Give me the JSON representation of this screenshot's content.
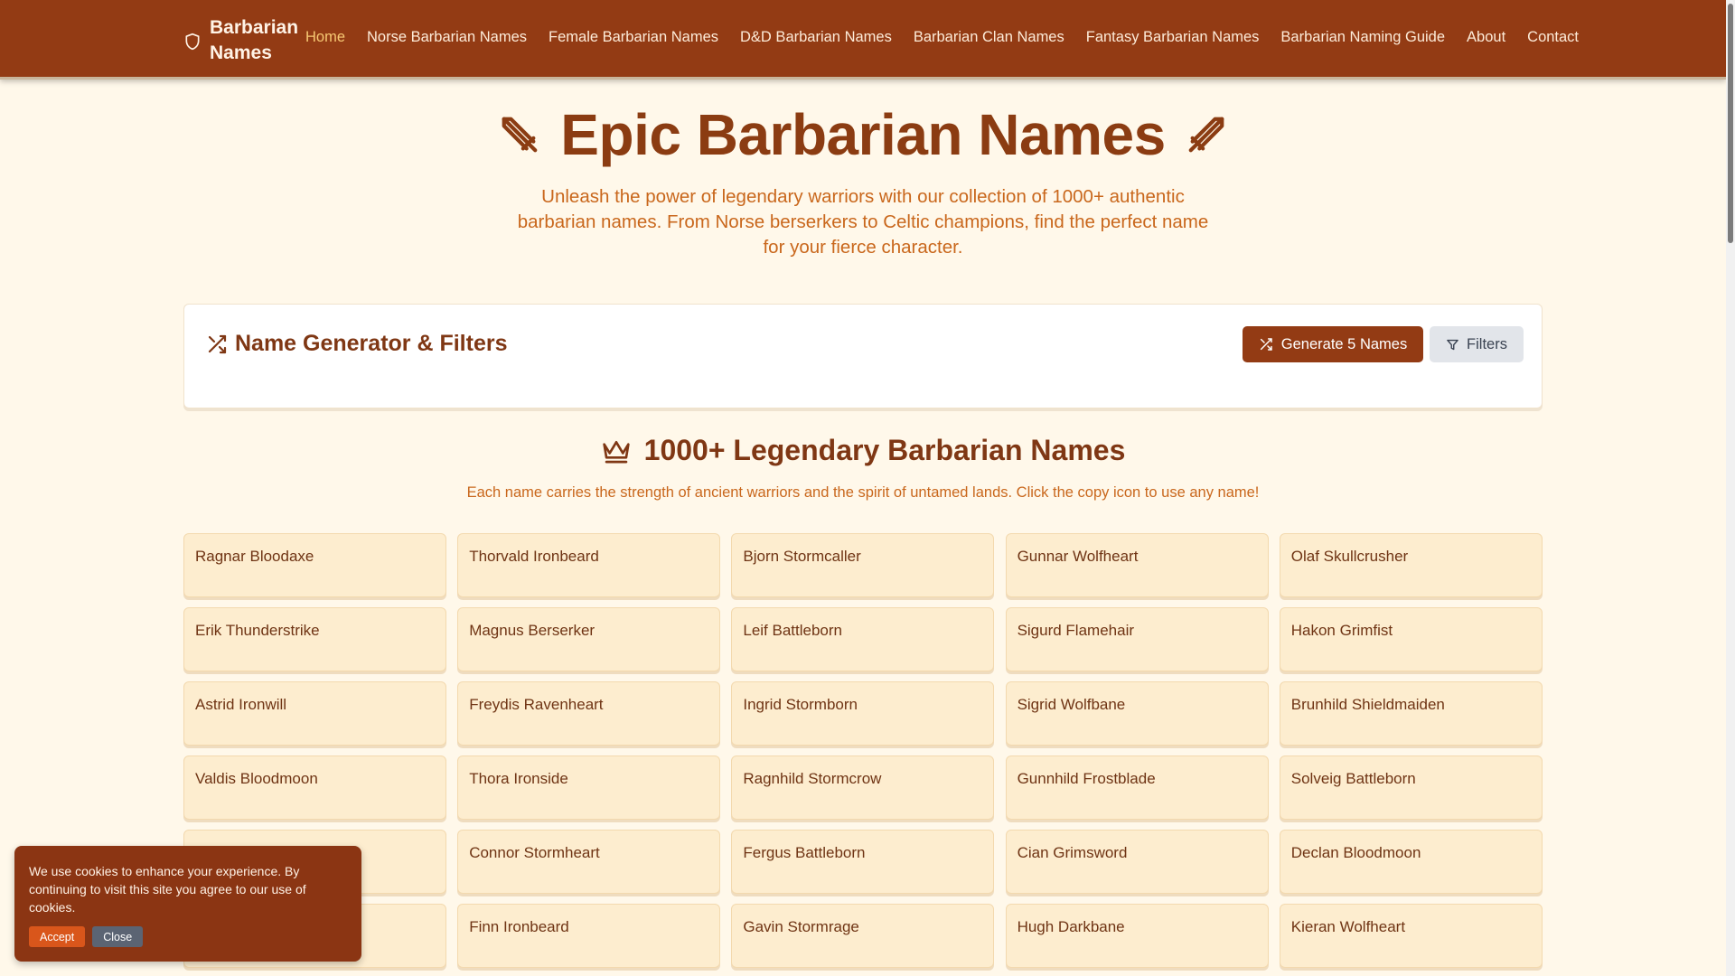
{
  "header": {
    "brand": "Barbarian Names",
    "nav": [
      {
        "label": "Home",
        "active": true
      },
      {
        "label": "Norse Barbarian Names"
      },
      {
        "label": "Female Barbarian Names"
      },
      {
        "label": "D&D Barbarian Names"
      },
      {
        "label": "Barbarian Clan Names"
      },
      {
        "label": "Fantasy Barbarian Names"
      },
      {
        "label": "Barbarian Naming Guide"
      },
      {
        "label": "About"
      },
      {
        "label": "Contact"
      }
    ]
  },
  "hero": {
    "title": "Epic Barbarian Names",
    "subtitle": "Unleash the power of legendary warriors with our collection of 1000+ authentic barbarian names. From Norse berserkers to Celtic champions, find the perfect name for your fierce character."
  },
  "generator": {
    "title": "Name Generator & Filters",
    "generate_label": "Generate 5 Names",
    "filters_label": "Filters"
  },
  "names_section": {
    "title": "1000+ Legendary Barbarian Names",
    "subtitle": "Each name carries the strength of ancient warriors and the spirit of untamed lands. Click the copy icon to use any name!",
    "names": [
      "Ragnar Bloodaxe",
      "Thorvald Ironbeard",
      "Bjorn Stormcaller",
      "Gunnar Wolfheart",
      "Olaf Skullcrusher",
      "Erik Thunderstrike",
      "Magnus Berserker",
      "Leif Battleborn",
      "Sigurd Flamehair",
      "Hakon Grimfist",
      "Astrid Ironwill",
      "Freydis Ravenheart",
      "Ingrid Stormborn",
      "Sigrid Wolfbane",
      "Brunhild Shieldmaiden",
      "Valdis Bloodmoon",
      "Thora Ironside",
      "Ragnhild Stormcrow",
      "Gunnhild Frostblade",
      "Solveig Battleborn",
      "",
      "Connor Stormheart",
      "Fergus Battleborn",
      "Cian Grimsword",
      "Declan Bloodmoon",
      "",
      "Finn Ironbeard",
      "Gavin Stormrage",
      "Hugh Darkbane",
      "Kieran Wolfheart"
    ]
  },
  "cookie": {
    "text": "We use cookies to enhance your experience. By continuing to visit this site you agree to our use of cookies.",
    "accept_label": "Accept",
    "close_label": "Close"
  },
  "colors": {
    "header_bg": "#933b14",
    "accent": "#8b3c12",
    "page_bg": "#fff8ea",
    "card_bg": "#fdedcf",
    "active_nav": "#f7c873"
  }
}
